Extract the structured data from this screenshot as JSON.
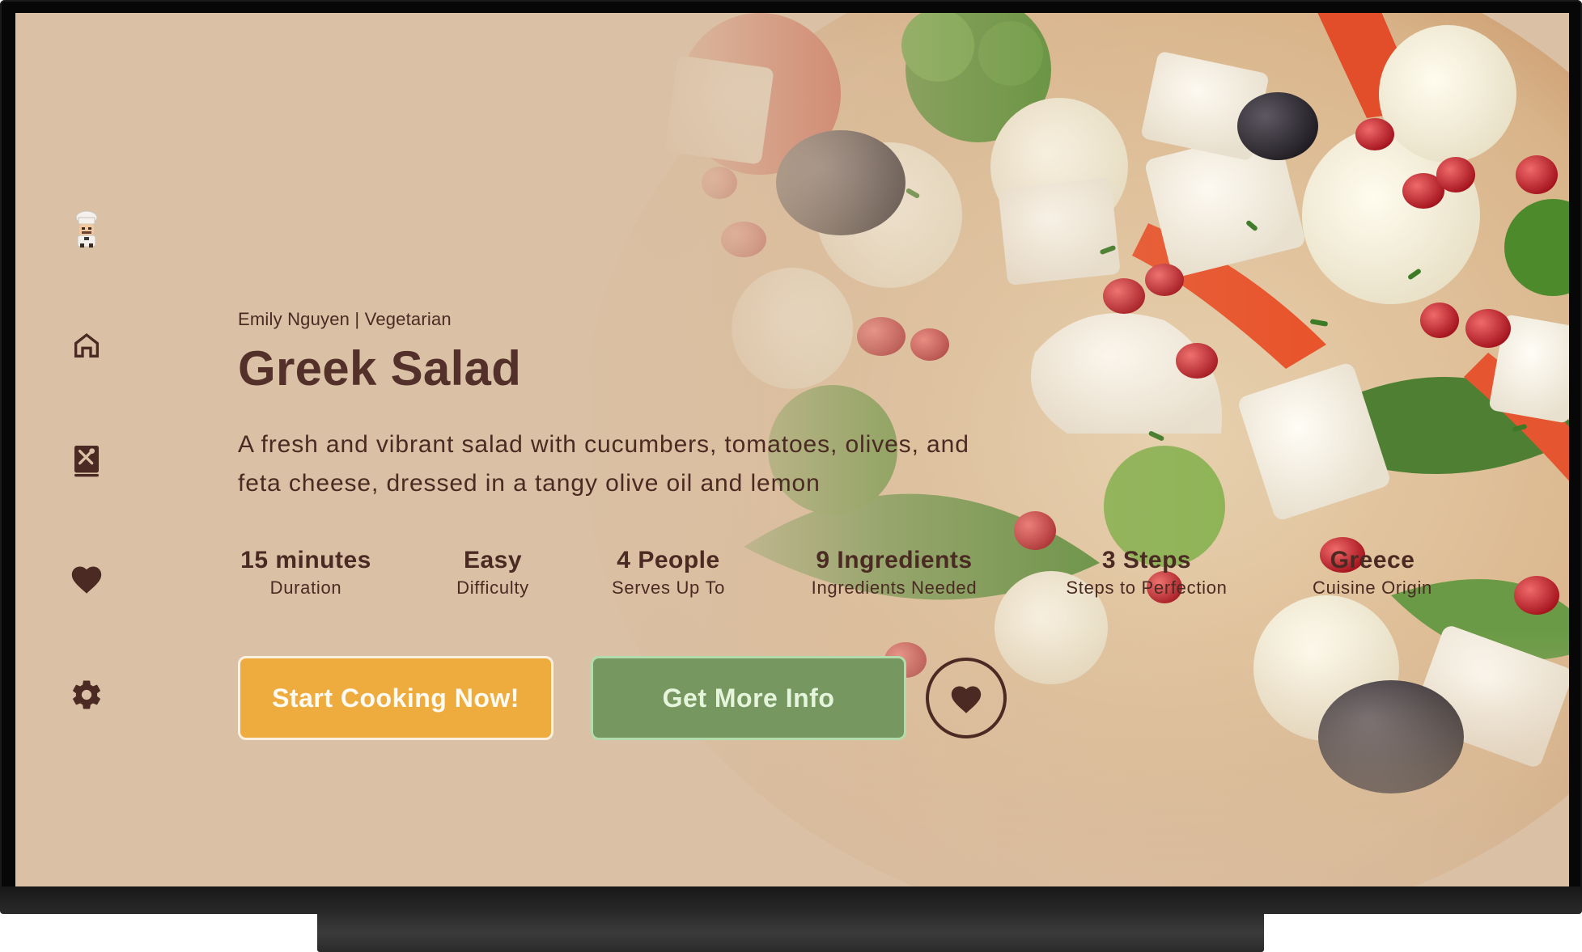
{
  "app": {
    "colors": {
      "screen_background": "#dac0a4",
      "text_primary": "#4a2a22",
      "primary_button": "#eeac3f",
      "secondary_button": "#76975f",
      "secondary_button_text": "#e5f5dc"
    }
  },
  "sidebar": {
    "items": [
      {
        "name": "chef-avatar",
        "icon": "chef-icon"
      },
      {
        "name": "home",
        "icon": "home-icon"
      },
      {
        "name": "recipes",
        "icon": "recipe-book-icon"
      },
      {
        "name": "favorites",
        "icon": "heart-icon"
      },
      {
        "name": "settings",
        "icon": "gear-icon"
      }
    ]
  },
  "recipe": {
    "meta": "Emily Nguyen | Vegetarian",
    "title": "Greek Salad",
    "description": "A fresh and vibrant salad with cucumbers, tomatoes, olives, and feta cheese, dressed in a tangy olive oil and lemon",
    "stats": [
      {
        "value": "15 minutes",
        "label": "Duration"
      },
      {
        "value": "Easy",
        "label": "Difficulty"
      },
      {
        "value": "4 People",
        "label": "Serves Up To"
      },
      {
        "value": "9 Ingredients",
        "label": "Ingredients Needed"
      },
      {
        "value": "3 Steps",
        "label": "Steps to Perfection"
      },
      {
        "value": "Greece",
        "label": "Cuisine Origin"
      }
    ]
  },
  "actions": {
    "start_label": "Start Cooking Now!",
    "info_label": "Get More Info",
    "favorite_icon": "heart-icon"
  }
}
